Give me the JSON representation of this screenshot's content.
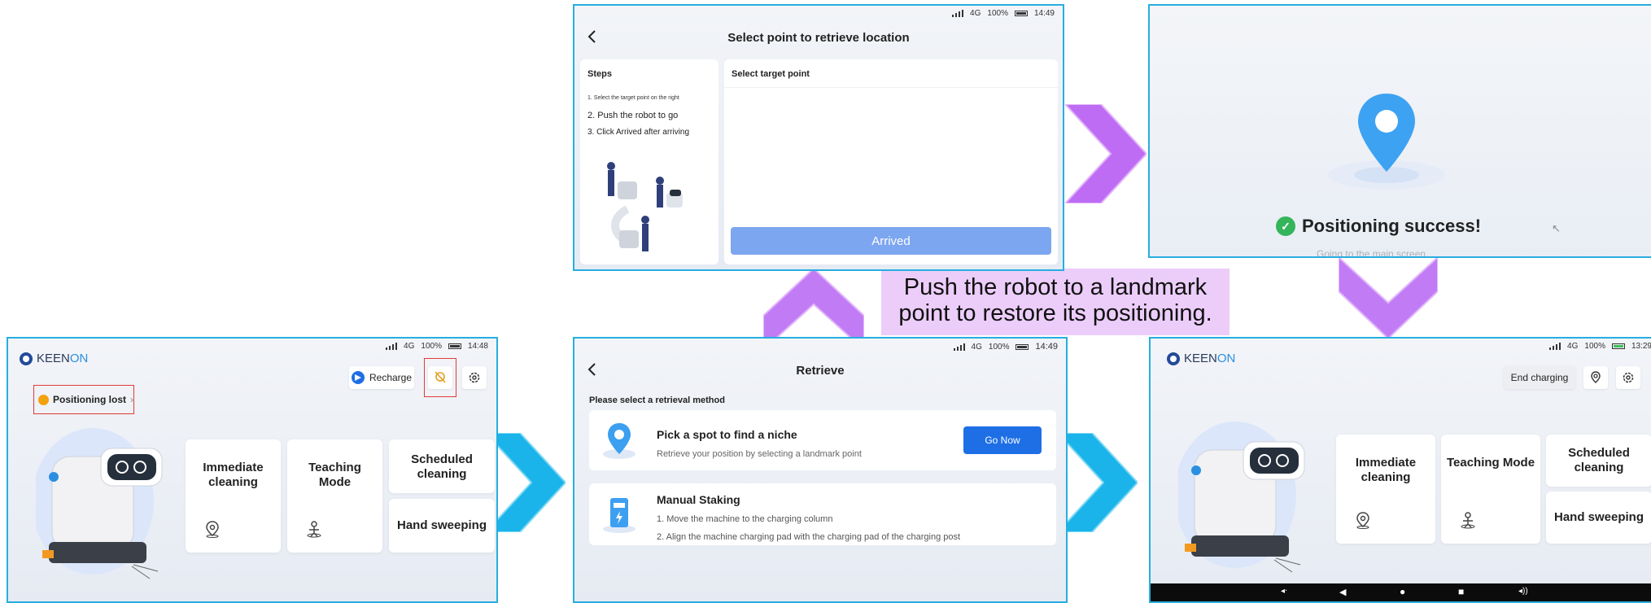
{
  "caption": {
    "line1": "Push the robot to a landmark",
    "line2": "point to restore its positioning."
  },
  "status_a": {
    "network": "4G",
    "battery": "100%",
    "time": "14:48"
  },
  "status_b": {
    "network": "4G",
    "battery": "100%",
    "time": "14:49"
  },
  "status_c": {
    "network": "4G",
    "battery": "100%",
    "time": "14:49"
  },
  "status_d": {
    "network": "4G",
    "battery": "100%",
    "time": "13:29"
  },
  "home": {
    "logo_prefix": "KEEN",
    "logo_suffix": "ON",
    "positioning_lost": "Positioning lost",
    "recharge": "Recharge",
    "end_charging": "End charging",
    "immediate_cleaning": "Immediate cleaning",
    "teaching_mode": "Teaching Mode",
    "scheduled_cleaning": "Scheduled cleaning",
    "hand_sweeping": "Hand sweeping"
  },
  "retrieve": {
    "title": "Retrieve",
    "prompt": "Please select a retrieval method",
    "option1_title": "Pick a spot to find a niche",
    "option1_desc": "Retrieve your position by selecting a landmark point",
    "go_now": "Go Now",
    "option2_title": "Manual Staking",
    "option2_step1": "1. Move the machine to the charging column",
    "option2_step2": "2. Align the machine charging pad with the charging pad of the charging post"
  },
  "select_point": {
    "title": "Select point to retrieve location",
    "steps_heading": "Steps",
    "step1": "1. Select the target point on the right",
    "step2": "2. Push the robot to go",
    "step3": "3. Click Arrived after arriving",
    "target_heading": "Select target point",
    "arrived": "Arrived"
  },
  "success": {
    "message": "Positioning success!",
    "sub": "Going to the main screen..."
  },
  "colors": {
    "frame": "#27aee0",
    "arrow_blue": "#1ab4ea",
    "arrow_purple": "#bf6cf5",
    "caption_bg": "#eccdfa",
    "go_now": "#1e6fe6",
    "arrived": "#7da6f0"
  }
}
